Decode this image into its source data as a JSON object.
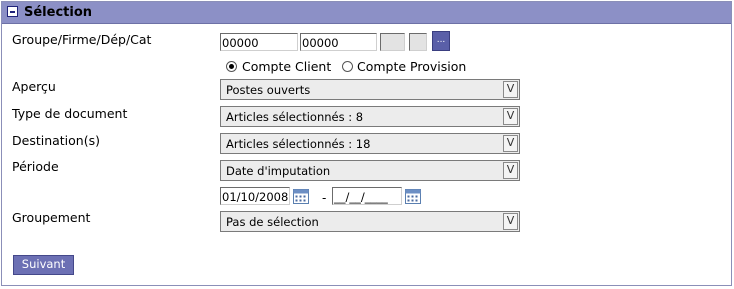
{
  "header": {
    "title": "Sélection"
  },
  "fields": {
    "groupe": {
      "label": "Groupe/Firme/Dép/Cat",
      "value1": "00000",
      "value2": "00000",
      "value3": "",
      "value4": "",
      "lookup_label": "..."
    },
    "compte": {
      "option1": "Compte Client",
      "option2": "Compte Provision",
      "selected": "Compte Client"
    },
    "apercu": {
      "label": "Aperçu",
      "value": "Postes ouverts"
    },
    "type_document": {
      "label": "Type de document",
      "value": "Articles sélectionnés : 8"
    },
    "destination": {
      "label": "Destination(s)",
      "value": "Articles sélectionnés : 18"
    },
    "periode": {
      "label": "Période",
      "value": "Date d'imputation",
      "date_from": "01/10/2008",
      "separator": "-",
      "date_to": "__/__/____"
    },
    "groupement": {
      "label": "Groupement",
      "value": "Pas de sélection"
    }
  },
  "buttons": {
    "next": "Suivant"
  },
  "select_arrow": "V"
}
